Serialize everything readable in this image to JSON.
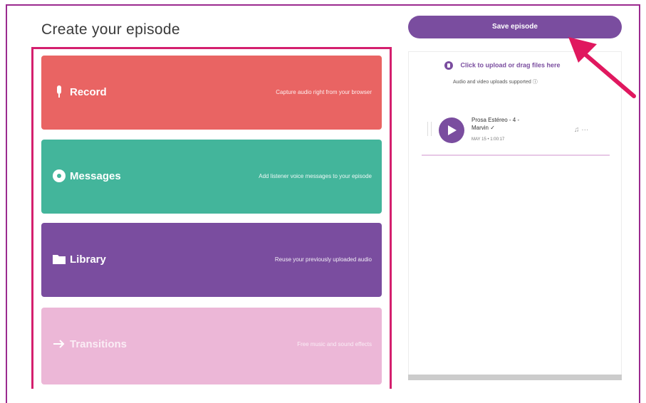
{
  "page": {
    "title": "Create your episode"
  },
  "cards": [
    {
      "key": "record",
      "label": "Record",
      "desc": "Capture audio right from your browser",
      "icon": "microphone-icon"
    },
    {
      "key": "messages",
      "label": "Messages",
      "desc": "Add listener voice messages to your episode",
      "icon": "message-bubble-icon"
    },
    {
      "key": "library",
      "label": "Library",
      "desc": "Reuse your previously uploaded audio",
      "icon": "folder-icon"
    },
    {
      "key": "transitions",
      "label": "Transitions",
      "desc": "Free music and sound effects",
      "icon": "arrow-right-icon"
    }
  ],
  "save_button": {
    "label": "Save episode"
  },
  "upload": {
    "label": "Click to upload or drag files here",
    "subtext": "Audio and video uploads supported ⓘ"
  },
  "episode": {
    "title_line1": "Prosa Estéreo - 4 -",
    "title_line2": "Marvin ✓",
    "meta": "MAY 15 • 1:00:17",
    "tools": "♫ ···"
  },
  "colors": {
    "record": "#e96463",
    "messages": "#43b59b",
    "library": "#7a4d9f",
    "transitions": "#ecb7d7",
    "highlight": "#d41f6e",
    "arrow": "#e0185f"
  }
}
